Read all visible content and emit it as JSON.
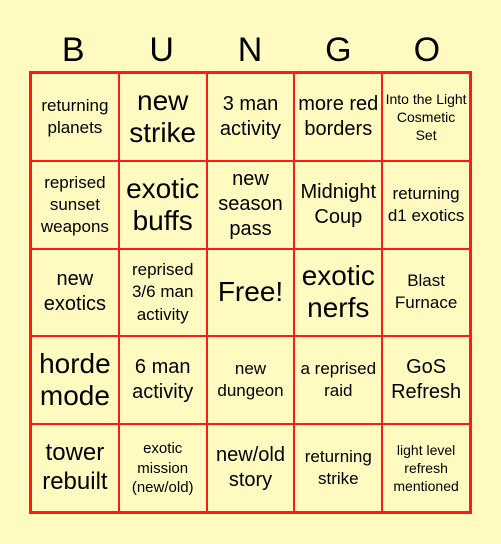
{
  "title_letters": [
    "B",
    "U",
    "N",
    "G",
    "O"
  ],
  "colors": {
    "background": "#FFFBC0",
    "border": "#FF1A1A",
    "text": "#000000"
  },
  "cells": [
    [
      "returning planets",
      "new strike",
      "3 man activity",
      "more red borders",
      "Into the Light Cosmetic Set"
    ],
    [
      "reprised sunset weapons",
      "exotic buffs",
      "new season pass",
      "Midnight Coup",
      "returning d1 exotics"
    ],
    [
      "new exotics",
      "reprised 3/6 man activity",
      "Free!",
      "exotic nerfs",
      "Blast Furnace"
    ],
    [
      "horde mode",
      "6 man activity",
      "new dungeon",
      "a reprised raid",
      "GoS Refresh"
    ],
    [
      "tower rebuilt",
      "exotic mission (new/old)",
      "new/old story",
      "returning strike",
      "light level refresh mentioned"
    ]
  ]
}
